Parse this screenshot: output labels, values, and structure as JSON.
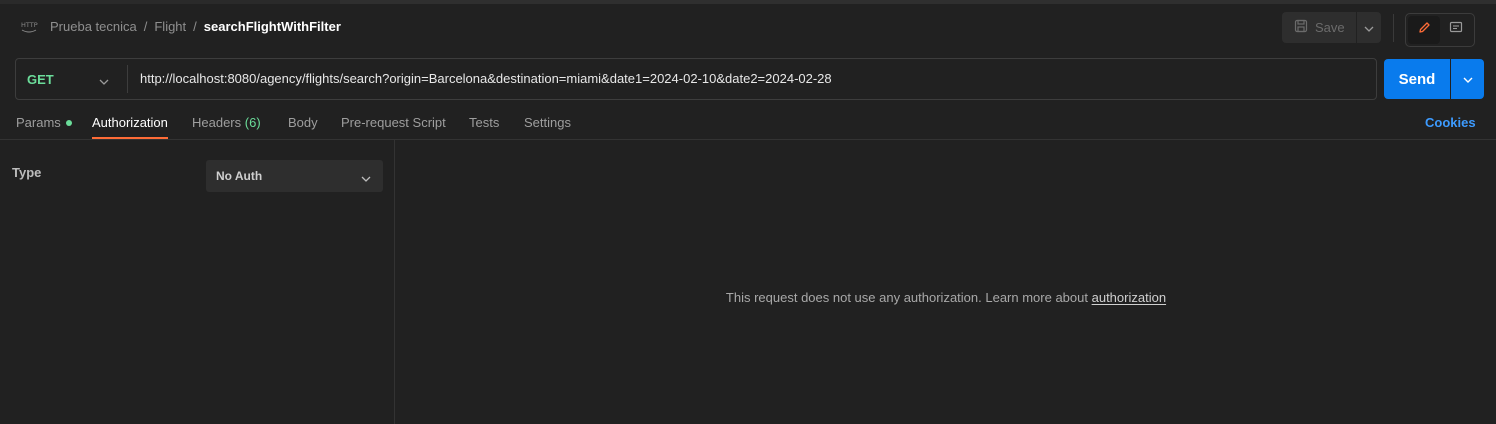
{
  "colors": {
    "background": "#212121",
    "method_get": "#6bdd9a",
    "send_button": "#097bed",
    "active_tab_underline": "#ff6c37",
    "cookies_link": "#3d9bff"
  },
  "header": {
    "icon": "http-icon",
    "breadcrumb": {
      "collection": "Prueba tecnica",
      "folder": "Flight",
      "separator": "/",
      "request": "searchFlightWithFilter"
    },
    "save_label": "Save",
    "save_icon": "floppy-disk-icon",
    "edit_icon": "pencil-icon",
    "comments_icon": "comment-icon"
  },
  "request": {
    "method": "GET",
    "url": "http://localhost:8080/agency/flights/search?origin=Barcelona&destination=miami&date1=2024-02-10&date2=2024-02-28",
    "send_label": "Send"
  },
  "tabs": [
    {
      "label": "Params",
      "has_dot": true,
      "active": false
    },
    {
      "label": "Authorization",
      "active": true
    },
    {
      "label": "Headers",
      "count": "(6)",
      "active": false
    },
    {
      "label": "Body",
      "active": false
    },
    {
      "label": "Pre-request Script",
      "active": false
    },
    {
      "label": "Tests",
      "active": false
    },
    {
      "label": "Settings",
      "active": false
    }
  ],
  "cookies_label": "Cookies",
  "auth": {
    "type_label": "Type",
    "selected": "No Auth",
    "message": "This request does not use any authorization. Learn more about",
    "link": "authorization"
  }
}
